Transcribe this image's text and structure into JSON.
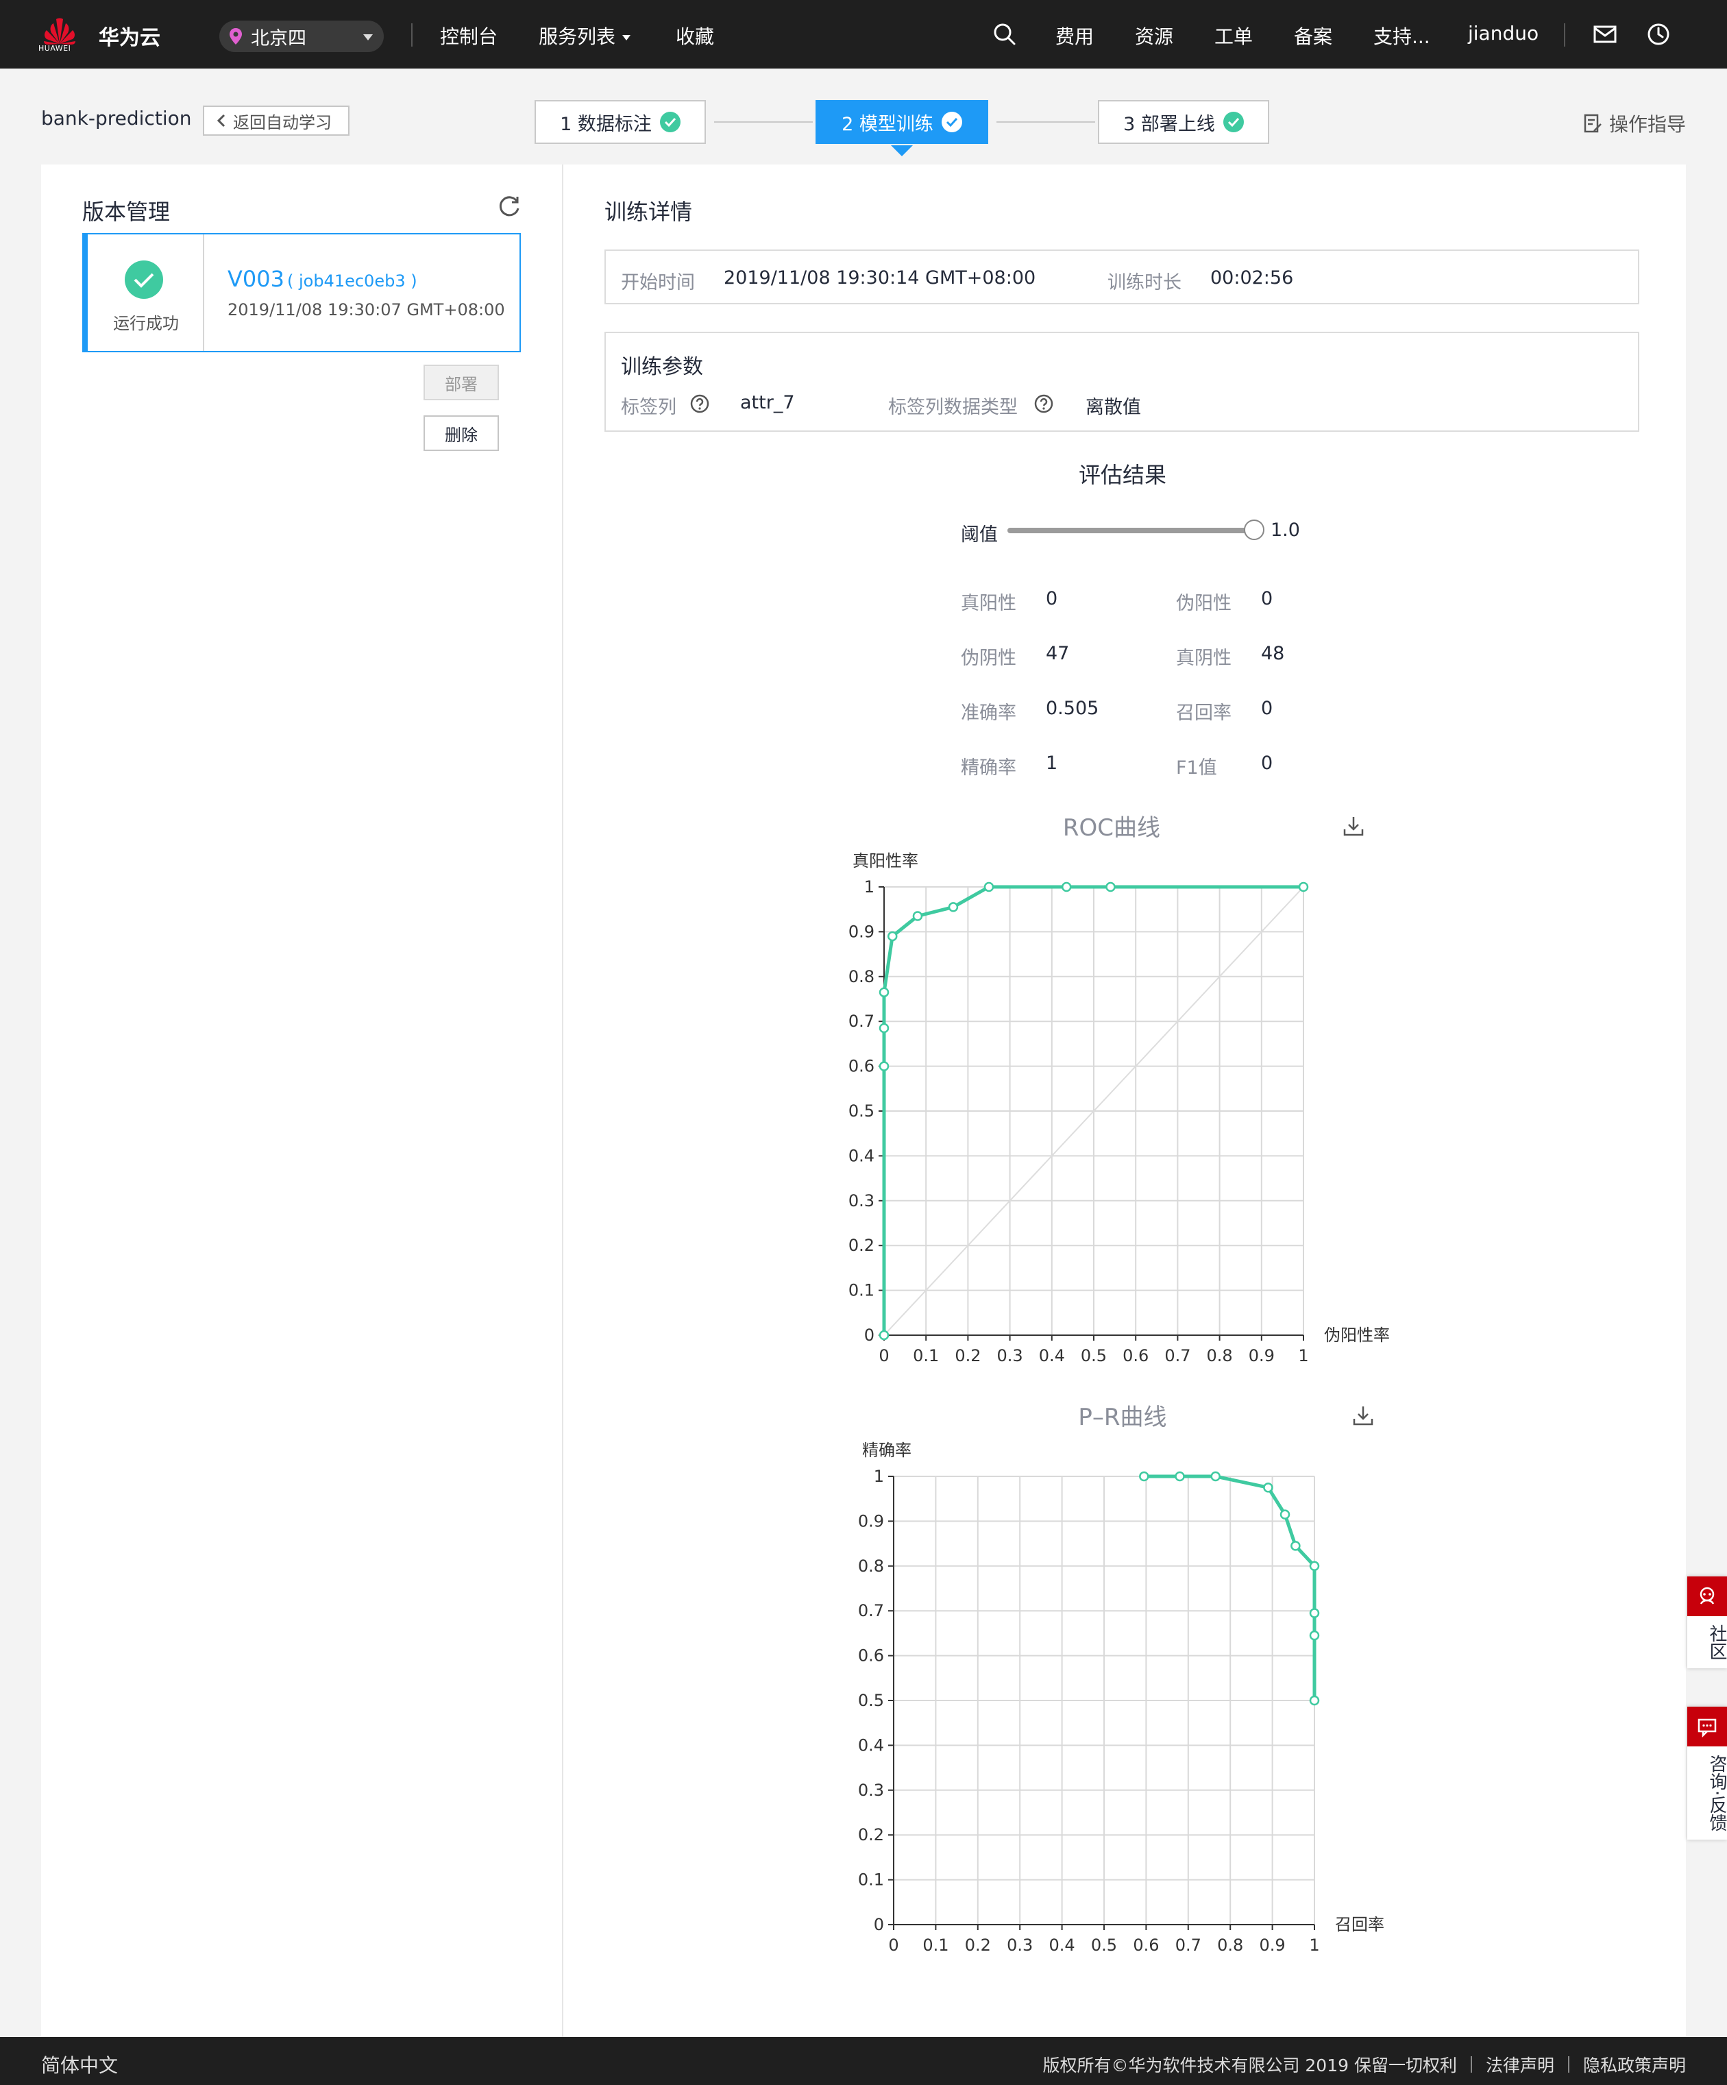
{
  "topnav": {
    "logo_text": "HUAWEI",
    "brand": "华为云",
    "region": "北京四",
    "items": [
      "控制台",
      "服务列表",
      "收藏"
    ],
    "right_items": [
      "费用",
      "资源",
      "工单",
      "备案",
      "支持...",
      "jianduo"
    ]
  },
  "subheader": {
    "project_name": "bank-prediction",
    "back_label": "返回自动学习",
    "steps": [
      "1 数据标注",
      "2 模型训练",
      "3 部署上线"
    ],
    "active_step": 2,
    "guide_label": "操作指导"
  },
  "version_panel": {
    "title": "版本管理",
    "version": "V003",
    "job": "( job41ec0eb3 )",
    "status": "运行成功",
    "created": "2019/11/08 19:30:07 GMT+08:00",
    "deploy_label": "部署",
    "delete_label": "删除"
  },
  "details": {
    "title": "训练详情",
    "start_label": "开始时间",
    "start_value": "2019/11/08 19:30:14 GMT+08:00",
    "duration_label": "训练时长",
    "duration_value": "00:02:56",
    "params_title": "训练参数",
    "label_col_label": "标签列",
    "label_col_value": "attr_7",
    "label_type_label": "标签列数据类型",
    "label_type_value": "离散值"
  },
  "evaluation": {
    "title": "评估结果",
    "threshold_label": "阈值",
    "threshold_value": "1.0",
    "threshold": 1.0,
    "metrics": [
      {
        "label": "真阳性",
        "value": "0"
      },
      {
        "label": "伪阳性",
        "value": "0"
      },
      {
        "label": "伪阴性",
        "value": "47"
      },
      {
        "label": "真阴性",
        "value": "48"
      },
      {
        "label": "准确率",
        "value": "0.505"
      },
      {
        "label": "召回率",
        "value": "0"
      },
      {
        "label": "精确率",
        "value": "1"
      },
      {
        "label": "F1值",
        "value": "0"
      }
    ]
  },
  "chart_data": [
    {
      "type": "line",
      "title": "ROC曲线",
      "xlabel": "伪阳性率",
      "ylabel": "真阳性率",
      "xlim": [
        0,
        1
      ],
      "ylim": [
        0,
        1
      ],
      "xticks": [
        "0",
        "0.1",
        "0.2",
        "0.3",
        "0.4",
        "0.5",
        "0.6",
        "0.7",
        "0.8",
        "0.9",
        "1"
      ],
      "yticks": [
        "0",
        "0.1",
        "0.2",
        "0.3",
        "0.4",
        "0.5",
        "0.6",
        "0.7",
        "0.8",
        "0.9",
        "1"
      ],
      "grid": true,
      "diagonal": true,
      "color": "#3fcaa0",
      "x": [
        0,
        0,
        0,
        0,
        0.02,
        0.08,
        0.165,
        0.25,
        0.435,
        0.54,
        1
      ],
      "y": [
        0,
        0.6,
        0.685,
        0.765,
        0.89,
        0.935,
        0.955,
        1,
        1,
        1,
        1
      ]
    },
    {
      "type": "line",
      "title": "P–R曲线",
      "xlabel": "召回率",
      "ylabel": "精确率",
      "xlim": [
        0,
        1
      ],
      "ylim": [
        0,
        1
      ],
      "xticks": [
        "0",
        "0.1",
        "0.2",
        "0.3",
        "0.4",
        "0.5",
        "0.6",
        "0.7",
        "0.8",
        "0.9",
        "1"
      ],
      "yticks": [
        "0",
        "0.1",
        "0.2",
        "0.3",
        "0.4",
        "0.5",
        "0.6",
        "0.7",
        "0.8",
        "0.9",
        "1"
      ],
      "grid": true,
      "color": "#3fcaa0",
      "x": [
        0.595,
        0.68,
        0.765,
        0.89,
        0.93,
        0.955,
        1,
        1,
        1,
        1
      ],
      "y": [
        1,
        1,
        1,
        0.975,
        0.915,
        0.845,
        0.8,
        0.695,
        0.645,
        0.5
      ]
    }
  ],
  "side": {
    "community": "社区",
    "feedback": "咨询·反馈"
  },
  "footer": {
    "language": "简体中文",
    "copyright": "版权所有©华为软件技术有限公司 2019 保留一切权利",
    "legal": "法律声明",
    "privacy": "隐私政策声明"
  }
}
